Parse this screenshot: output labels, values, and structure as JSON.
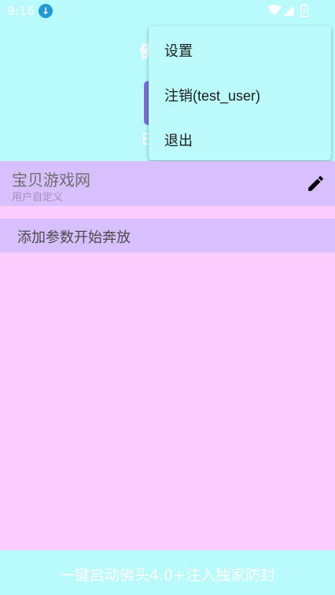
{
  "status_bar": {
    "time": "9:16"
  },
  "menu": {
    "items": [
      {
        "label": "设置"
      },
      {
        "label": "注销(test_user)"
      },
      {
        "label": "退出"
      }
    ]
  },
  "header": {
    "title_stub": "佛",
    "text_stub": "E"
  },
  "site": {
    "name": "宝贝游戏网",
    "subtitle": "用户自定义"
  },
  "add_params": {
    "label": "添加参数开始奔放"
  },
  "bottom_bar": {
    "label": "一键启动佛头4.0+注入独家防封"
  },
  "colors": {
    "accent_cyan": "#b9fbfc",
    "background_pink": "#fbcdfe",
    "row_purple": "#d8bffd",
    "button_violet": "#7a6ce6"
  }
}
